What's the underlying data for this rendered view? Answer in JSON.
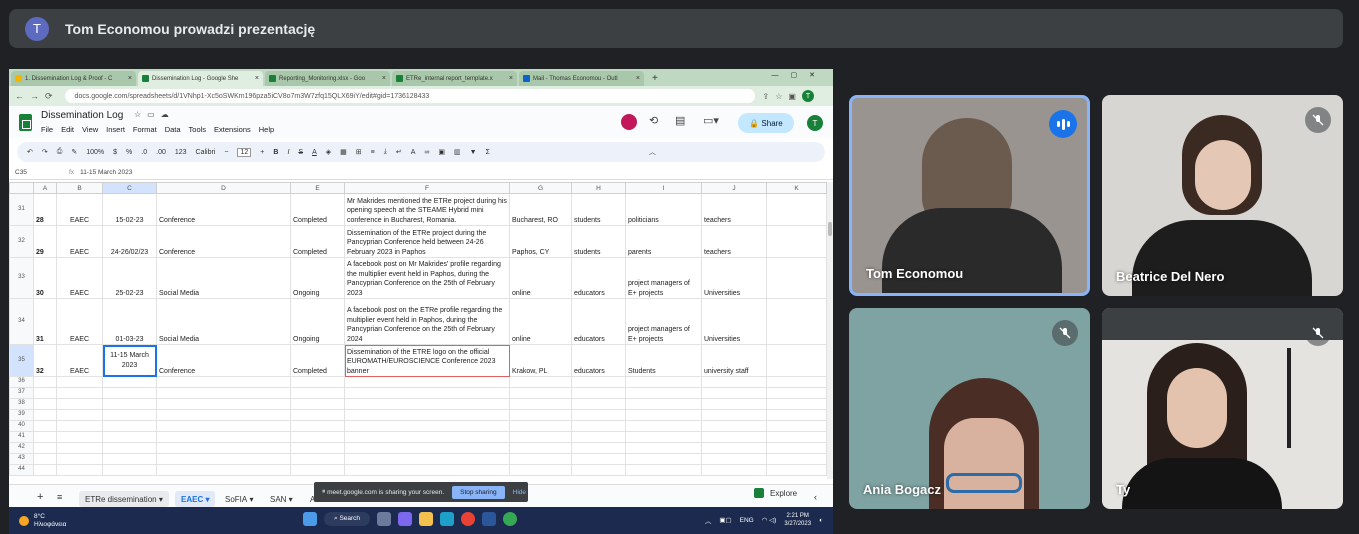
{
  "meet": {
    "presenter_initial": "T",
    "presenting_title": "Tom Economou prowadzi prezentację"
  },
  "browser": {
    "tabs": [
      {
        "label": "1. Dissemination Log & Proof - C",
        "color": "#f4b400"
      },
      {
        "label": "Dissemination Log - Google She",
        "color": "#188038"
      },
      {
        "label": "Reporting_Monitoring.xlsx - Goo",
        "color": "#188038"
      },
      {
        "label": "ETRe_internal report_template.x",
        "color": "#188038"
      },
      {
        "label": "Mail - Thomas Economou - Outl",
        "color": "#0a64c8"
      }
    ],
    "url": "docs.google.com/spreadsheets/d/1VNhp1-Xc5oSWKm196pza5iCV8o7m3W7zfq15QLX69iY/edit#gid=1736128433",
    "profile_initial": "T"
  },
  "sheet": {
    "title": "Dissemination Log",
    "menu": [
      "File",
      "Edit",
      "View",
      "Insert",
      "Format",
      "Data",
      "Tools",
      "Extensions",
      "Help"
    ],
    "share_label": "Share",
    "user_initial": "T",
    "toolbar": {
      "zoom": "100%",
      "currency": "$",
      "percent": "%",
      "dec_dec": ".0",
      "dec_inc": ".00",
      "num_fmt": "123",
      "font": "Calibri",
      "size": "12"
    },
    "cell_ref": "C35",
    "formula": "11-15 March 2023",
    "columns": [
      "A",
      "B",
      "C",
      "D",
      "E",
      "F",
      "G",
      "H",
      "I",
      "J",
      "K"
    ],
    "rows": [
      {
        "rn": "31",
        "a": "28",
        "b": "EAEC",
        "c": "15-02-23",
        "d": "Conference",
        "e": "Completed",
        "f": "Mr Makrides mentioned the ETRe project during his opening speech at the STEAME Hybrid mini conference in Bucharest, Romania.",
        "g": "Bucharest, RO",
        "h": "students",
        "i": "politicians",
        "j": "teachers"
      },
      {
        "rn": "32",
        "a": "29",
        "b": "EAEC",
        "c": "24-26/02/23",
        "d": "Conference",
        "e": "Completed",
        "f": "Dissemination of the ETRe project during the Pancyprian Conference held between 24-26 February 2023 in Paphos",
        "g": "Paphos, CY",
        "h": "students",
        "i": "parents",
        "j": "teachers"
      },
      {
        "rn": "33",
        "a": "30",
        "b": "EAEC",
        "c": "25-02-23",
        "d": "Social Media",
        "e": "Ongoing",
        "f": "A facebook post on Mr Makrides' profile regarding the multiplier event held in Paphos, during the Pancyprian Conference on the 25th of February 2023",
        "g": "online",
        "h": "educators",
        "i": "project managers of E+ projects",
        "j": "Universities"
      },
      {
        "rn": "34",
        "a": "31",
        "b": "EAEC",
        "c": "01-03-23",
        "d": "Social Media",
        "e": "Ongoing",
        "f": "A facebook post on the ETRe profile regarding the multiplier event held in Paphos, during the Pancyprian Conference on the 25th of February 2024",
        "g": "online",
        "h": "educators",
        "i": "project managers of E+ projects",
        "j": "Universities"
      },
      {
        "rn": "35",
        "a": "32",
        "b": "EAEC",
        "c": "11-15 March 2023",
        "d": "Conference",
        "e": "Completed",
        "f": "Dissemination of the ETRE logo on the official EUROMATH/EUROSCIENCE Conference 2023 banner",
        "g": "Krakow, PL",
        "h": "educators",
        "i": "Students",
        "j": "university staff"
      }
    ],
    "empty_rows": [
      "36",
      "37",
      "38",
      "39",
      "40",
      "41",
      "42",
      "43",
      "44"
    ],
    "sheet_tabs": [
      "ETRe dissemination",
      "EAEC",
      "SoFIA",
      "SAN",
      "A"
    ],
    "explore_label": "Explore"
  },
  "sharing_bar": {
    "text": "meet.google.com is sharing your screen.",
    "stop": "Stop sharing",
    "hide": "Hide"
  },
  "taskbar": {
    "temp": "8°C",
    "weather": "Ηλιοφάνεια",
    "search": "Search",
    "lang": "ENG",
    "time": "2:21 PM",
    "date": "3/27/2023"
  },
  "participants": [
    {
      "name": "Tom Economou",
      "speaking": true
    },
    {
      "name": "Beatrice Del Nero",
      "muted": true
    },
    {
      "name": "Ania Bogacz",
      "muted": true
    },
    {
      "name": "Ty",
      "muted": true
    }
  ]
}
